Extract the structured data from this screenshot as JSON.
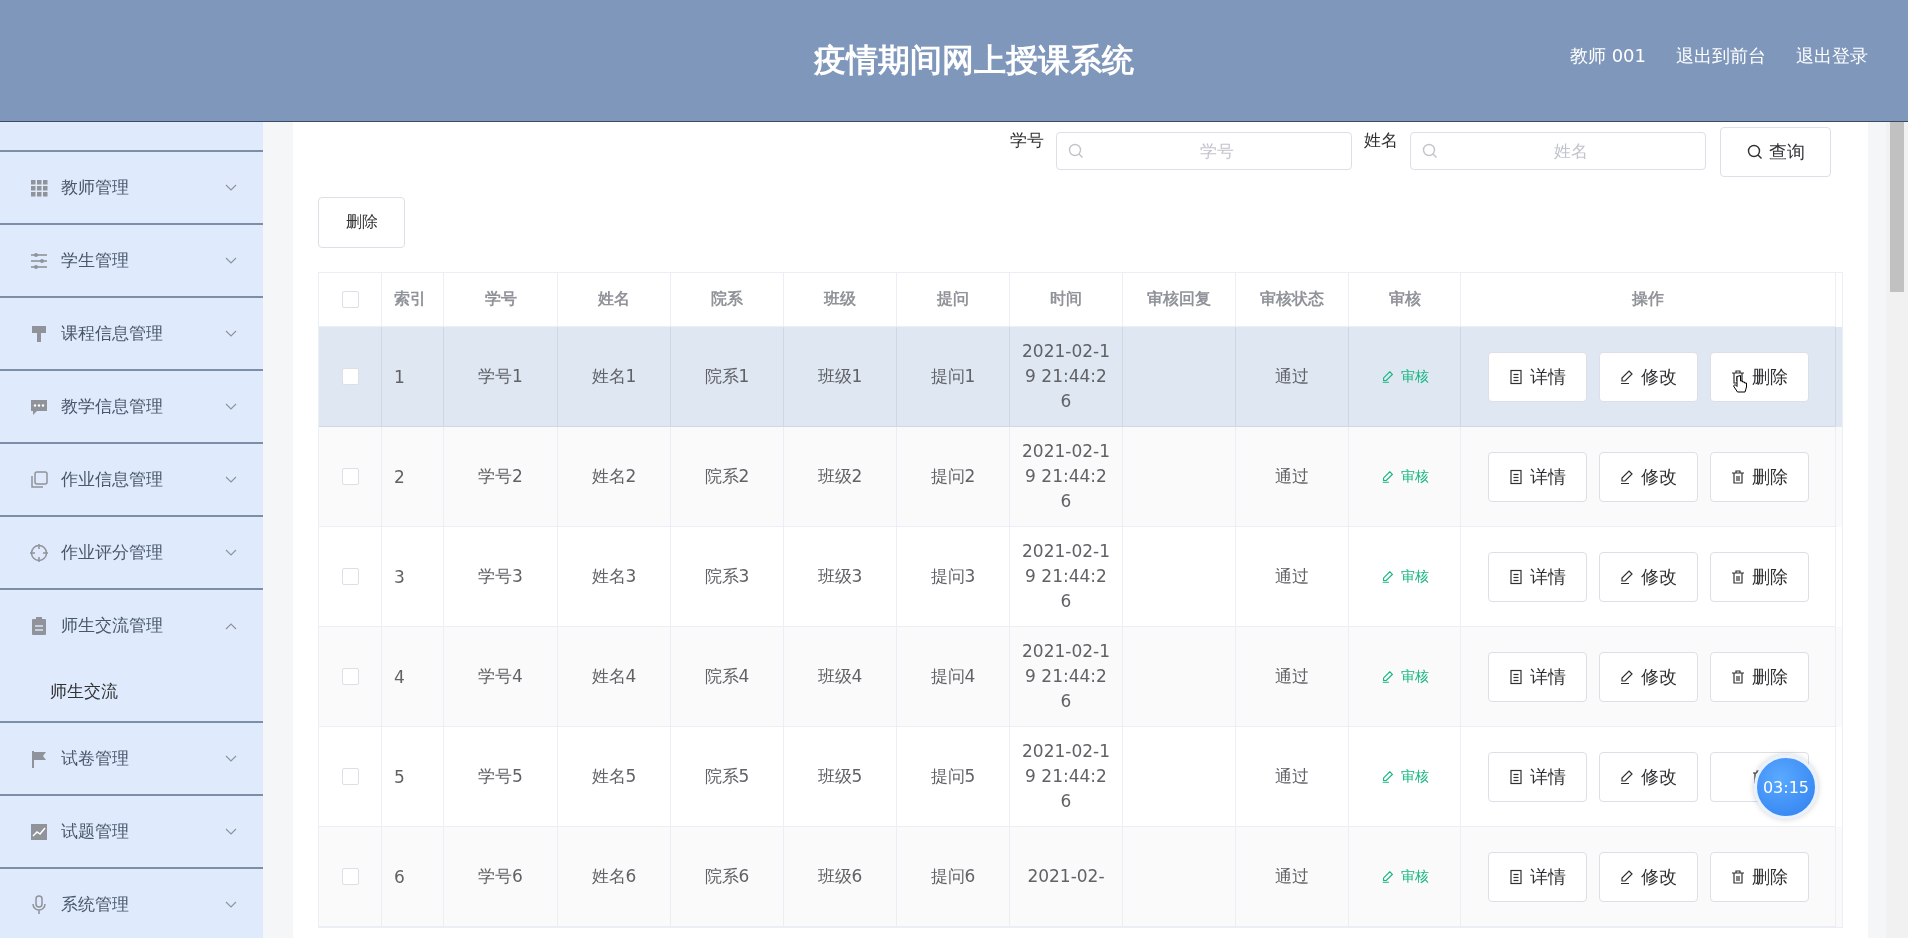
{
  "header": {
    "title": "疫情期间网上授课系统",
    "links": [
      "教师 001",
      "退出到前台",
      "退出登录"
    ]
  },
  "sidebar": {
    "items": [
      {
        "label": "教师管理",
        "expanded": false
      },
      {
        "label": "学生管理",
        "expanded": false
      },
      {
        "label": "课程信息管理",
        "expanded": false
      },
      {
        "label": "教学信息管理",
        "expanded": false
      },
      {
        "label": "作业信息管理",
        "expanded": false
      },
      {
        "label": "作业评分管理",
        "expanded": false
      },
      {
        "label": "师生交流管理",
        "expanded": true,
        "children": [
          {
            "label": "师生交流"
          }
        ]
      },
      {
        "label": "试卷管理",
        "expanded": false
      },
      {
        "label": "试题管理",
        "expanded": false
      },
      {
        "label": "系统管理",
        "expanded": false
      }
    ]
  },
  "search": {
    "fields": [
      {
        "label": "学号",
        "placeholder": "学号"
      },
      {
        "label": "姓名",
        "placeholder": "姓名"
      }
    ],
    "button": "查询"
  },
  "delete_button": "删除",
  "table": {
    "all_checked": false,
    "columns": [
      "索引",
      "学号",
      "姓名",
      "院系",
      "班级",
      "提问",
      "时间",
      "审核回复",
      "审核状态",
      "审核",
      "操作"
    ],
    "rows": [
      {
        "checked": false,
        "hovered": true,
        "cells": [
          "1",
          "学号1",
          "姓名1",
          "院系1",
          "班级1",
          "提问1",
          "2021-02-19 21:44:26",
          "",
          "通过"
        ],
        "review": "审核",
        "actions": [
          {
            "kind": "detail",
            "label": "详情"
          },
          {
            "kind": "edit",
            "label": "修改"
          },
          {
            "kind": "delete",
            "label": "删除"
          }
        ]
      },
      {
        "checked": false,
        "hovered": false,
        "cells": [
          "2",
          "学号2",
          "姓名2",
          "院系2",
          "班级2",
          "提问2",
          "2021-02-19 21:44:26",
          "",
          "通过"
        ],
        "review": "审核",
        "actions": [
          {
            "kind": "detail",
            "label": "详情"
          },
          {
            "kind": "edit",
            "label": "修改"
          },
          {
            "kind": "delete",
            "label": "删除"
          }
        ]
      },
      {
        "checked": false,
        "hovered": false,
        "cells": [
          "3",
          "学号3",
          "姓名3",
          "院系3",
          "班级3",
          "提问3",
          "2021-02-19 21:44:26",
          "",
          "通过"
        ],
        "review": "审核",
        "actions": [
          {
            "kind": "detail",
            "label": "详情"
          },
          {
            "kind": "edit",
            "label": "修改"
          },
          {
            "kind": "delete",
            "label": "删除"
          }
        ]
      },
      {
        "checked": false,
        "hovered": false,
        "cells": [
          "4",
          "学号4",
          "姓名4",
          "院系4",
          "班级4",
          "提问4",
          "2021-02-19 21:44:26",
          "",
          "通过"
        ],
        "review": "审核",
        "actions": [
          {
            "kind": "detail",
            "label": "详情"
          },
          {
            "kind": "edit",
            "label": "修改"
          },
          {
            "kind": "delete",
            "label": "删除"
          }
        ]
      },
      {
        "checked": false,
        "hovered": false,
        "cells": [
          "5",
          "学号5",
          "姓名5",
          "院系5",
          "班级5",
          "提问5",
          "2021-02-19 21:44:26",
          "",
          "通过"
        ],
        "review": "审核",
        "actions": [
          {
            "kind": "detail",
            "label": "详情"
          },
          {
            "kind": "edit",
            "label": "修改"
          },
          {
            "kind": "delete"
          }
        ]
      },
      {
        "checked": false,
        "hovered": false,
        "cells": [
          "6",
          "学号6",
          "姓名6",
          "院系6",
          "班级6",
          "提问6",
          "2021-02-",
          "",
          "通过"
        ],
        "review": "审核",
        "actions": [
          {
            "kind": "detail",
            "label": "详情"
          },
          {
            "kind": "edit",
            "label": "修改"
          },
          {
            "kind": "delete",
            "label": "删除"
          }
        ]
      }
    ]
  },
  "timer": "03:15"
}
